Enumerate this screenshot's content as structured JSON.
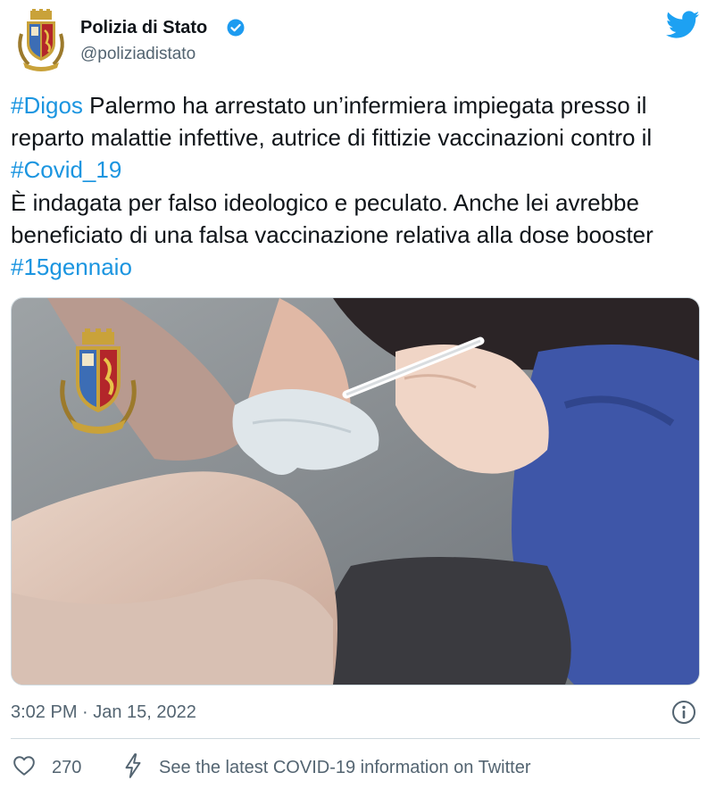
{
  "author": {
    "name": "Polizia di Stato",
    "handle": "@poliziadistato",
    "avatar_icon": "polizia-crest-icon",
    "verified_icon": "verified-badge-icon"
  },
  "brand": {
    "icon": "twitter-bird-icon",
    "color": "#1da1f2"
  },
  "tweet": {
    "parts": [
      {
        "text": "#Digos",
        "hashtag": true
      },
      {
        "text": " Palermo ha arrestato un’infermiera impiegata presso il reparto malattie infettive, autrice di fittizie vaccinazioni contro il ",
        "hashtag": false
      },
      {
        "text": "#Covid_19",
        "hashtag": true
      },
      {
        "text": "\nÈ indagata per falso ideologico e peculato. Anche lei avrebbe beneficiato di una falsa vaccinazione relativa alla dose booster ",
        "hashtag": false
      },
      {
        "text": "#15gennaio",
        "hashtag": true
      }
    ],
    "hashtag_color": "#1b95e0"
  },
  "meta": {
    "timestamp": "3:02 PM · Jan 15, 2022",
    "info_icon": "info-icon"
  },
  "actions": {
    "like_icon": "heart-icon",
    "like_count": "270",
    "covid_icon": "lightning-bolt-icon",
    "covid_link": "See the latest COVID-19 information on Twitter"
  },
  "colors": {
    "text": "#0f1419",
    "muted": "#536471",
    "border": "#cfd9de"
  }
}
